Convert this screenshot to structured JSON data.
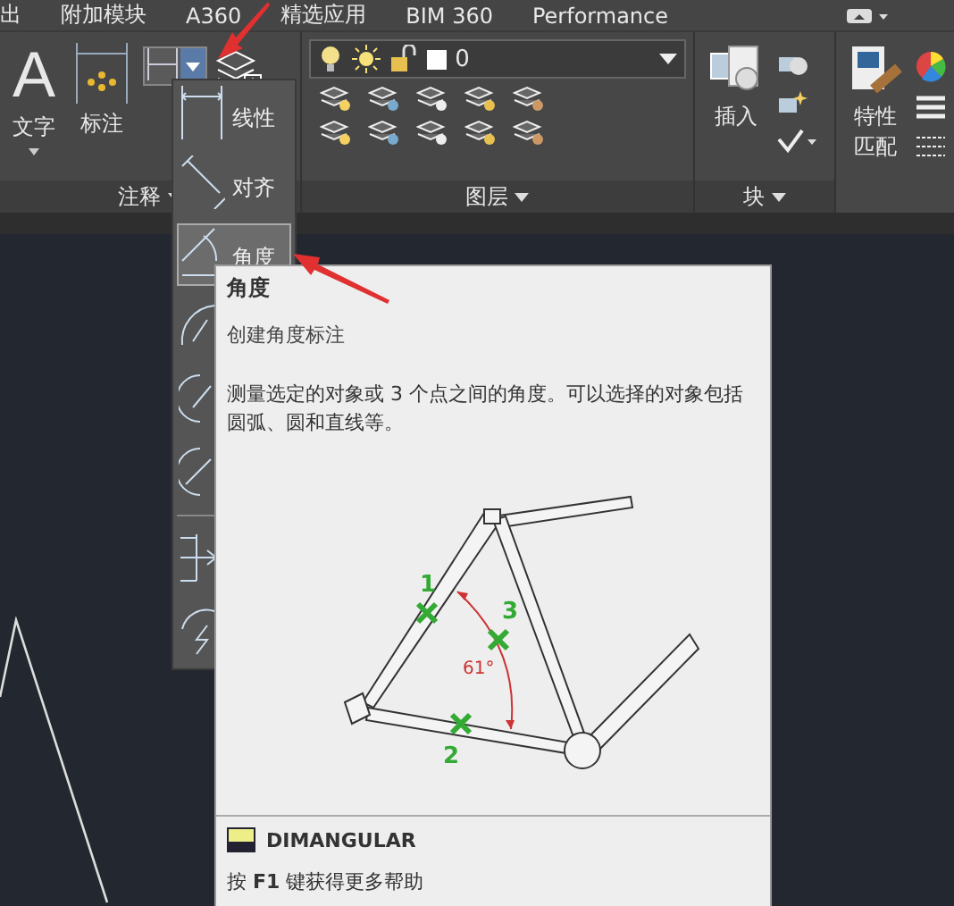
{
  "tabs": [
    "出",
    "附加模块",
    "A360",
    "精选应用",
    "BIM 360",
    "Performance"
  ],
  "ribbon": {
    "text_tool": {
      "glyph": "A",
      "label": "文字"
    },
    "dim_tool": {
      "label": "标注"
    },
    "layer_combo": {
      "value": "0"
    },
    "insert": {
      "label": "插入"
    },
    "match": {
      "label": "特性匹配"
    },
    "panels": [
      "注释",
      "图层",
      "块"
    ]
  },
  "dropdown": {
    "items": [
      {
        "kind": "linear",
        "label": "线性",
        "selected": false
      },
      {
        "kind": "aligned",
        "label": "对齐",
        "selected": false
      },
      {
        "kind": "angular",
        "label": "角度",
        "selected": true
      },
      {
        "kind": "arc",
        "selected": false
      },
      {
        "kind": "radius",
        "selected": false
      },
      {
        "kind": "diameter",
        "selected": false
      },
      {
        "kind": "separator"
      },
      {
        "kind": "ordinate",
        "selected": false
      },
      {
        "kind": "jogged",
        "selected": false
      }
    ]
  },
  "tooltip": {
    "title": "角度",
    "subtitle": "创建角度标注",
    "description": "测量选定的对象或 3 个点之间的角度。可以选择的对象包括圆弧、圆和直线等。",
    "figure": {
      "points": [
        {
          "label": "1"
        },
        {
          "label": "3"
        },
        {
          "label": "2"
        }
      ],
      "angle": "61°"
    },
    "command": "DIMANGULAR",
    "help": "按 **F1** 键获得更多帮助"
  }
}
